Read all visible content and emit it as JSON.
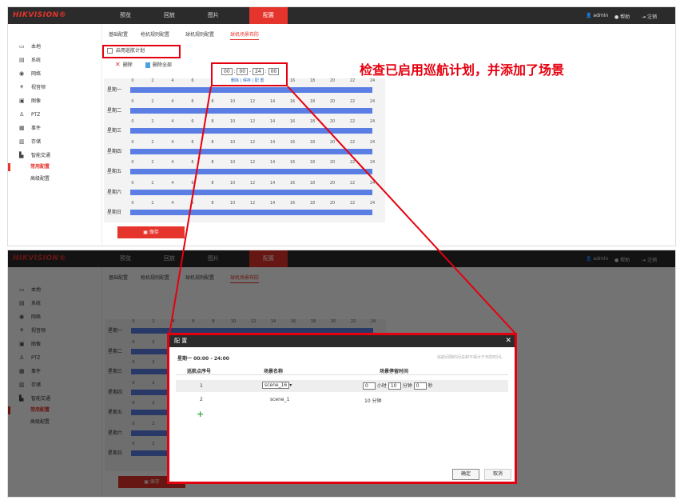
{
  "app": {
    "logo": "HIKVISION®"
  },
  "nav": [
    {
      "label": "预览"
    },
    {
      "label": "回放"
    },
    {
      "label": "图片"
    },
    {
      "label": "配置"
    }
  ],
  "topright": {
    "user": "admin",
    "help": "帮助",
    "logout": "注销"
  },
  "sidebar": {
    "items": [
      {
        "icon": "monitor-icon",
        "label": "本地"
      },
      {
        "icon": "system-icon",
        "label": "系统"
      },
      {
        "icon": "network-icon",
        "label": "网络"
      },
      {
        "icon": "video-icon",
        "label": "视音频"
      },
      {
        "icon": "image-icon",
        "label": "图像"
      },
      {
        "icon": "ptz-icon",
        "label": "PTZ"
      },
      {
        "icon": "event-icon",
        "label": "事件"
      },
      {
        "icon": "storage-icon",
        "label": "存储"
      },
      {
        "icon": "traffic-icon",
        "label": "智能交通"
      },
      {
        "label": "常用配置"
      },
      {
        "label": "高级配置"
      }
    ]
  },
  "tabs": [
    {
      "label": "基础配置"
    },
    {
      "label": "枪机规则配置"
    },
    {
      "label": "球机规则配置"
    },
    {
      "label": "球机场景布防"
    }
  ],
  "cruise_checkbox": {
    "label": "启用巡航计划"
  },
  "toolbar": {
    "delete": "删除",
    "delete_all": "删除全部"
  },
  "time_popup": {
    "h1": "00",
    "m1": "00",
    "h2": "24",
    "m2": "00",
    "links": "删除 | 保存 | 配 置"
  },
  "schedule": {
    "ticks": [
      "0",
      "2",
      "4",
      "6",
      "8",
      "10",
      "12",
      "14",
      "16",
      "18",
      "20",
      "22",
      "24"
    ],
    "days": [
      "星期一",
      "星期二",
      "星期三",
      "星期四",
      "星期五",
      "星期六",
      "星期日"
    ]
  },
  "save_label": "保存",
  "annotation": "检查已启用巡航计划，并添加了场景",
  "dialog": {
    "title": "配 置",
    "subtitle": "星期一   00:00  -  24:00",
    "hint": "巡航间隔时间总和不得大于布防时间。",
    "headers": {
      "index": "巡航点序号",
      "scene": "场景名称",
      "time": "场景停留时间"
    },
    "rows": [
      {
        "index": "1",
        "scene": "scene_16",
        "hour": "0",
        "hour_unit": "小时",
        "minute": "10",
        "minute_unit": "分钟",
        "second": "0",
        "second_unit": "秒"
      },
      {
        "index": "2",
        "scene": "scene_1",
        "time": "10 分钟"
      }
    ],
    "ok": "确定",
    "cancel": "取消"
  },
  "colors": {
    "accent": "#e5342b",
    "bar": "#5b7ee5",
    "annotation": "#e5000f",
    "header": "#2b2b2b"
  }
}
